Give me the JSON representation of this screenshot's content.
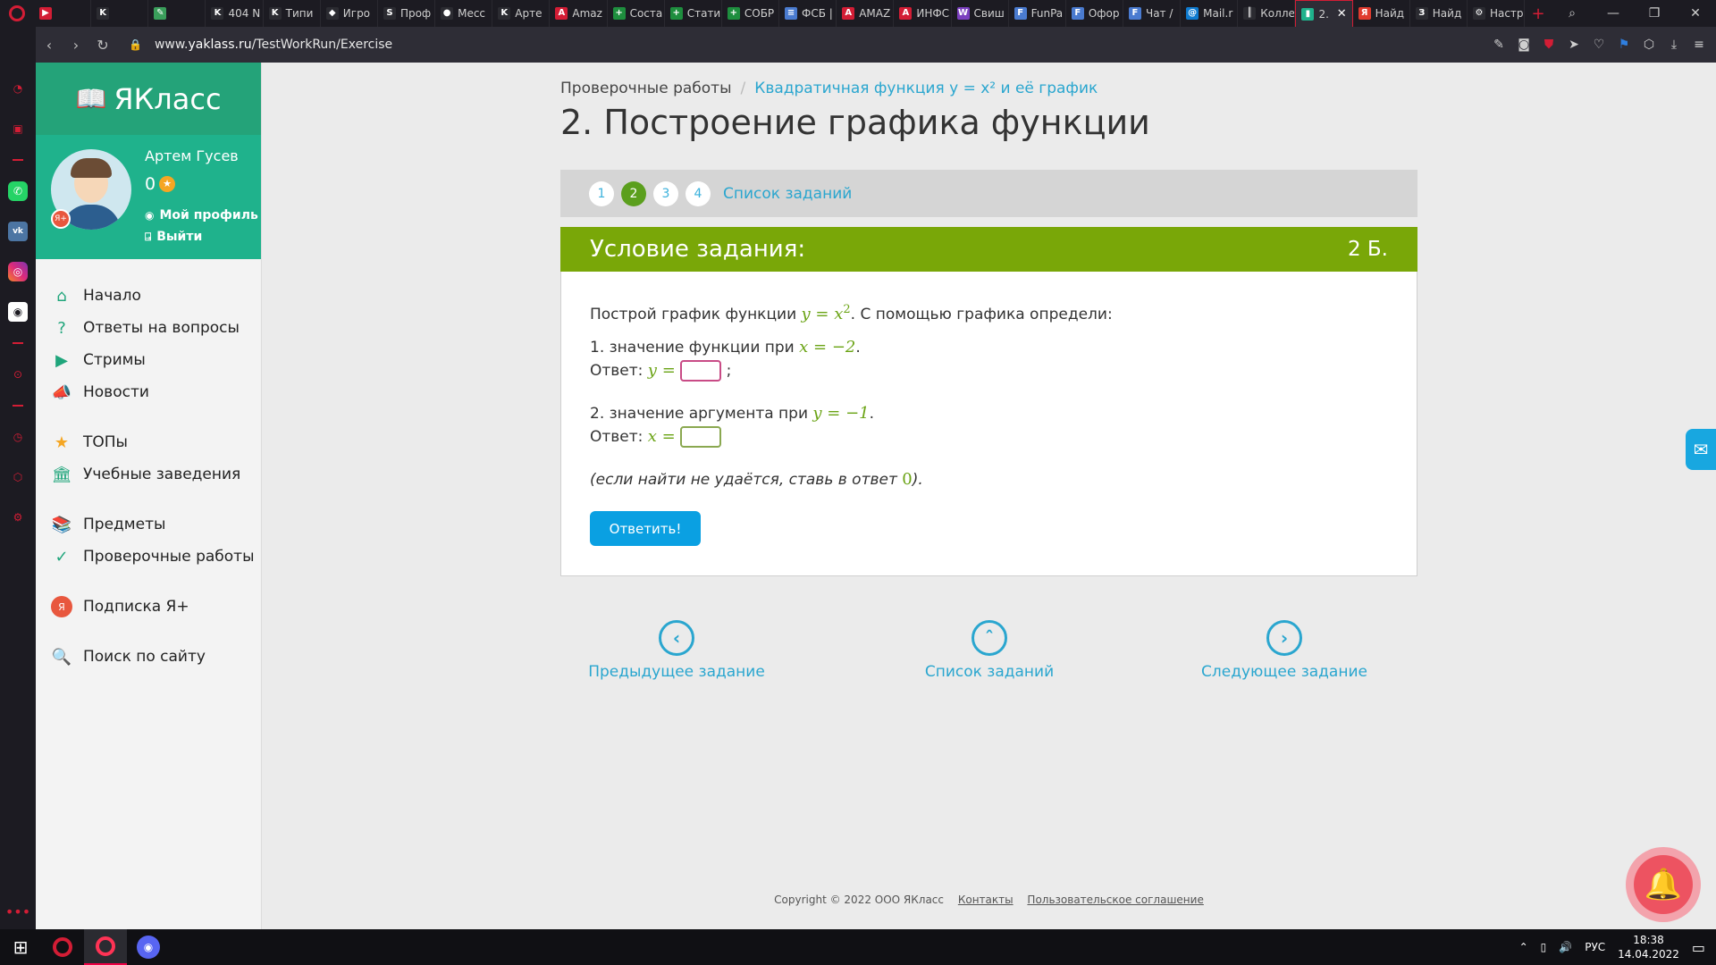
{
  "browser": {
    "tabs": [
      {
        "label": "",
        "fav": "▶",
        "color": "#d31d35"
      },
      {
        "label": "",
        "fav": "K",
        "color": "#2b2b31"
      },
      {
        "label": "",
        "fav": "✎",
        "color": "#3a9e5b"
      },
      {
        "label": "404 N",
        "fav": "K",
        "color": "#2b2b31"
      },
      {
        "label": "Типи",
        "fav": "K",
        "color": "#2b2b31"
      },
      {
        "label": "Игро",
        "fav": "◆",
        "color": "#2b2b31"
      },
      {
        "label": "Проф",
        "fav": "S",
        "color": "#2b2b31"
      },
      {
        "label": "Месс",
        "fav": "●",
        "color": "#2b2b31"
      },
      {
        "label": "Арте",
        "fav": "K",
        "color": "#2b2b31"
      },
      {
        "label": "Amaz",
        "fav": "A",
        "color": "#d31d35"
      },
      {
        "label": "Соста",
        "fav": "+",
        "color": "#1e8e3e"
      },
      {
        "label": "Стати",
        "fav": "+",
        "color": "#1e8e3e"
      },
      {
        "label": "СОБР",
        "fav": "+",
        "color": "#1e8e3e"
      },
      {
        "label": "ФСБ |",
        "fav": "≡",
        "color": "#4a7bd0"
      },
      {
        "label": "AMAZ",
        "fav": "A",
        "color": "#d31d35"
      },
      {
        "label": "ИНФС",
        "fav": "A",
        "color": "#d31d35"
      },
      {
        "label": "Свиш",
        "fav": "W",
        "color": "#7b3fbf"
      },
      {
        "label": "FunPa",
        "fav": "F",
        "color": "#4a7bd0"
      },
      {
        "label": "Офор",
        "fav": "F",
        "color": "#4a7bd0"
      },
      {
        "label": "Чат /",
        "fav": "F",
        "color": "#4a7bd0"
      },
      {
        "label": "Mail.r",
        "fav": "@",
        "color": "#0e7bd0"
      },
      {
        "label": "Колле",
        "fav": "║",
        "color": "#2b2b31"
      },
      {
        "label": "2.",
        "fav": "▮",
        "color": "#1fb28c",
        "active": true
      },
      {
        "label": "Найд",
        "fav": "Я",
        "color": "#e03b2e"
      },
      {
        "label": "Найд",
        "fav": "З",
        "color": "#2b2b31"
      },
      {
        "label": "Настр",
        "fav": "⚙",
        "color": "#2b2b31"
      }
    ],
    "url_prefix": "www.",
    "url_domain": "yaklass.ru",
    "url_path": "/TestWorkRun/Exercise"
  },
  "site": {
    "logo": "ЯКласс",
    "user": {
      "name": "Артем Гусев",
      "points": "0",
      "profile_link": "Мой профиль",
      "logout_link": "Выйти"
    },
    "menu": [
      {
        "label": "Начало",
        "icon": "⌂",
        "name": "home-icon"
      },
      {
        "label": "Ответы на вопросы",
        "icon": "?",
        "name": "question-icon"
      },
      {
        "label": "Стримы",
        "icon": "▶",
        "name": "stream-icon"
      },
      {
        "label": "Новости",
        "icon": "📣",
        "name": "news-icon"
      },
      {
        "label": "ТОПы",
        "icon": "★",
        "name": "star-icon"
      },
      {
        "label": "Учебные заведения",
        "icon": "🏛",
        "name": "school-icon"
      },
      {
        "label": "Предметы",
        "icon": "📚",
        "name": "books-icon"
      },
      {
        "label": "Проверочные работы",
        "icon": "✓",
        "name": "check-icon"
      },
      {
        "label": "Подписка Я+",
        "icon": "Я",
        "name": "subscription-icon"
      },
      {
        "label": "Поиск по сайту",
        "icon": "🔍",
        "name": "search-icon"
      }
    ]
  },
  "content": {
    "breadcrumb_root": "Проверочные работы",
    "breadcrumb_topic": "Квадратичная функция y = x² и её график",
    "title": "2. Построение графика функции",
    "steps": [
      "1",
      "2",
      "3",
      "4"
    ],
    "current_step": "2",
    "task_list_link": "Список заданий",
    "condition_title": "Условие задания:",
    "points": "2 Б.",
    "intro_before": "Построй график функции ",
    "intro_math": "y = x",
    "intro_exp": "2",
    "intro_after": ". С помощью графика определи:",
    "q1_text": "1. значение функции при ",
    "q1_math": "x = −2",
    "q1_answer_label": "Ответ: ",
    "q1_answer_math": "y =",
    "q1_suffix": ";",
    "q2_text": "2. значение аргумента при ",
    "q2_math": "y = −1",
    "q2_answer_label": "Ответ: ",
    "q2_answer_math": "x =",
    "hint_before": "(если найти не удаётся, ставь в ответ ",
    "hint_math": "0",
    "hint_after": ").",
    "submit": "Ответить!",
    "prev_task": "Предыдущее задание",
    "list_tasks": "Список заданий",
    "next_task": "Следующее задание",
    "footer_copyright": "Copyright © 2022 ООО ЯКласс",
    "footer_contacts": "Контакты",
    "footer_agreement": "Пользовательское соглашение"
  },
  "taskbar": {
    "lang": "РУС",
    "time": "18:38",
    "date": "14.04.2022"
  }
}
